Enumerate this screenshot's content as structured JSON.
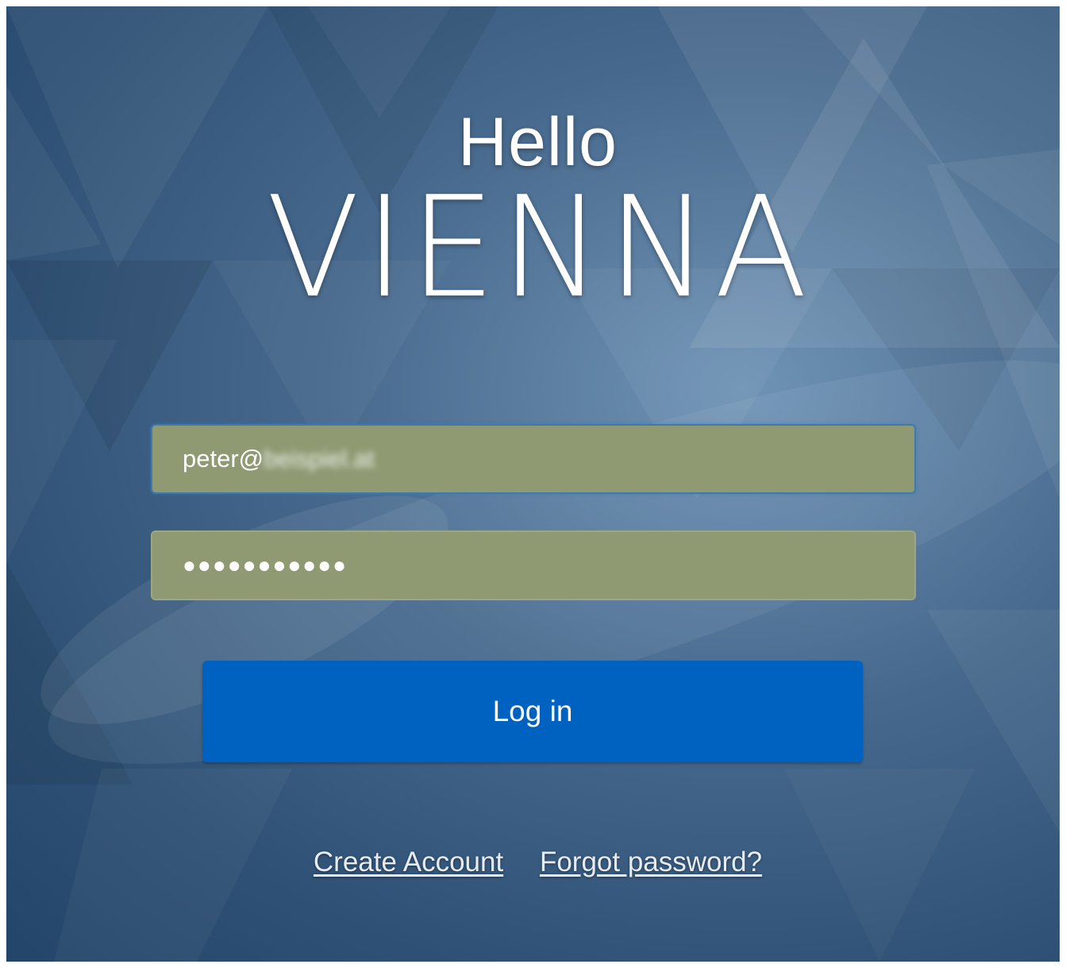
{
  "brand": {
    "line1": "Hello",
    "line2": "VIENNA"
  },
  "login_form": {
    "email_value_visible": "peter@",
    "email_value_obscured": "beispiel.at",
    "password_mask": "●●●●●●●●●●●",
    "login_label": "Log in"
  },
  "links": {
    "create_account": "Create Account",
    "forgot_password": "Forgot password?"
  },
  "colors": {
    "background": "#2f5175",
    "field_fill": "#8f9a73",
    "button": "#0062c0",
    "text": "#ffffff"
  }
}
